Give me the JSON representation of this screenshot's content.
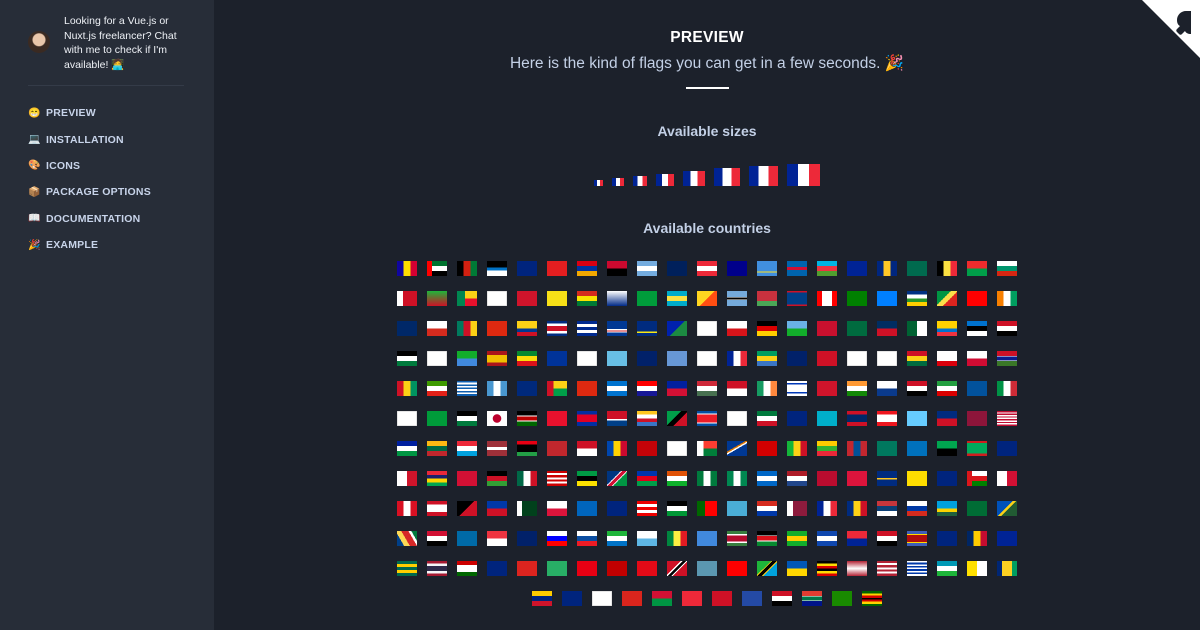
{
  "sidebar": {
    "promo_text": "Looking for a Vue.js or Nuxt.js freelancer? Chat with me to check if I'm available! 🧑‍💻",
    "items": [
      {
        "icon": "😁",
        "label": "PREVIEW",
        "icon_name": "grinning-face-icon"
      },
      {
        "icon": "💻",
        "label": "INSTALLATION",
        "icon_name": "laptop-icon"
      },
      {
        "icon": "🎨",
        "label": "ICONS",
        "icon_name": "palette-icon"
      },
      {
        "icon": "📦",
        "label": "PACKAGE OPTIONS",
        "icon_name": "package-icon"
      },
      {
        "icon": "📖",
        "label": "DOCUMENTATION",
        "icon_name": "book-icon"
      },
      {
        "icon": "🎉",
        "label": "EXAMPLE",
        "icon_name": "party-popper-icon"
      }
    ]
  },
  "main": {
    "title": "PREVIEW",
    "subtitle": "Here is the kind of flags you can get in a few seconds. 🎉",
    "sizes_heading": "Available sizes",
    "countries_heading": "Available countries"
  },
  "size_flag": "fr",
  "size_count": 8,
  "colors": {
    "background": "#1c212b",
    "sidebar": "#272d38",
    "nav_text": "#c8d4ea",
    "heading": "#c3d0e6",
    "corner": "#ffffff"
  },
  "countries": [
    "ad",
    "ae",
    "af",
    "ag",
    "ai",
    "al",
    "am",
    "ao",
    "ar",
    "as",
    "at",
    "au",
    "aw",
    "ax",
    "az",
    "ba",
    "bb",
    "bd",
    "be",
    "bf",
    "bg",
    "bh",
    "bi",
    "bj",
    "bl",
    "bm",
    "bn",
    "bo",
    "bq",
    "br",
    "bs",
    "bt",
    "bw",
    "by",
    "bz",
    "ca",
    "cc",
    "cd",
    "cf",
    "cg",
    "ch",
    "ci",
    "ck",
    "cl",
    "cm",
    "cn",
    "co",
    "cr",
    "cu",
    "cv",
    "cw",
    "cx",
    "cy",
    "cz",
    "de",
    "dj",
    "dk",
    "dm",
    "do",
    "dz",
    "ec",
    "ee",
    "eg",
    "eh",
    "en",
    "er",
    "es",
    "et",
    "eu",
    "fi",
    "fj",
    "fk",
    "fm",
    "fo",
    "fr",
    "ga",
    "gb",
    "gd",
    "ge",
    "gg",
    "gh",
    "gi",
    "gl",
    "gm",
    "gn",
    "gq",
    "gr",
    "gt",
    "gu",
    "gw",
    "hk",
    "hn",
    "hr",
    "ht",
    "hu",
    "id",
    "ie",
    "il",
    "im",
    "in",
    "io",
    "iq",
    "ir",
    "is",
    "it",
    "je",
    "jm",
    "jo",
    "jp",
    "ke",
    "kg",
    "kh",
    "ki",
    "km",
    "kn",
    "kp",
    "kr",
    "kw",
    "ky",
    "kz",
    "la",
    "lb",
    "lc",
    "li",
    "lk",
    "lr",
    "ls",
    "lt",
    "lu",
    "lv",
    "ly",
    "ma",
    "mc",
    "md",
    "me",
    "mf",
    "mg",
    "mh",
    "mk",
    "ml",
    "mm",
    "mn",
    "mo",
    "mp",
    "mq",
    "mr",
    "ms",
    "mt",
    "mu",
    "mv",
    "mw",
    "mx",
    "my",
    "mz",
    "na",
    "nc",
    "ne",
    "nf",
    "ng",
    "ni",
    "nl",
    "no",
    "np",
    "nr",
    "nu",
    "nz",
    "om",
    "pa",
    "pe",
    "pf",
    "pg",
    "ph",
    "pk",
    "pl",
    "pm",
    "pn",
    "pr",
    "ps",
    "pt",
    "pw",
    "py",
    "qa",
    "re",
    "ro",
    "rs",
    "ru",
    "rw",
    "sa",
    "sb",
    "sc",
    "sd",
    "se",
    "sg",
    "sh",
    "si",
    "sk",
    "sl",
    "sm",
    "sn",
    "so",
    "sr",
    "ss",
    "st",
    "sv",
    "sx",
    "sy",
    "sz",
    "tc",
    "td",
    "tf",
    "tg",
    "th",
    "tj",
    "tk",
    "tl",
    "tm",
    "tn",
    "to",
    "tr",
    "tt",
    "tv",
    "tw",
    "tz",
    "ua",
    "ug",
    "um",
    "us",
    "uy",
    "uz",
    "va",
    "vc",
    "ve",
    "vg",
    "vi",
    "vn",
    "vu",
    "wf",
    "ws",
    "xk",
    "ye",
    "za",
    "zm",
    "zw"
  ],
  "flag_styles": {
    "fr": "linear-gradient(90deg,#002395 33.3%,#fff 33.3% 66.6%,#ed2939 66.6%)",
    "ad": "linear-gradient(90deg,#10069f 33%,#fedd00 33% 67%,#d50032 67%)",
    "ae": "linear-gradient(90deg,#ff0000 25%,transparent 25%),linear-gradient(#00732f 33%,#fff 33% 66%,#000 66%)",
    "af": "linear-gradient(90deg,#000 33%,#d32011 33% 67%,#007a36 67%)",
    "ag": "linear-gradient(#000 45%,#0072c6 45% 62%,#fff 62%)",
    "ai": "linear-gradient(#00247d,#00247d)",
    "al": "linear-gradient(#e41e20,#e41e20)",
    "am": "linear-gradient(#d90012 33%,#0033a0 33% 67%,#f2a800 67%)",
    "ao": "linear-gradient(#cc092f 50%,#000 50%)",
    "ar": "linear-gradient(#74acdf 33%,#fff 33% 67%,#74acdf 67%)",
    "as": "linear-gradient(#00205b,#00205b)",
    "at": "linear-gradient(#ed2939 33%,#fff 33% 67%,#ed2939 67%)",
    "au": "linear-gradient(#00008b,#00008b)",
    "aw": "linear-gradient(#418fde 70%,#fbe122 70% 78%,#418fde 78%)",
    "ax": "linear-gradient(#0064ad 40%,#d21034 40% 60%,#0064ad 60%)",
    "az": "linear-gradient(#00b5e2 33%,#ef3340 33% 67%,#509e2f 67%)",
    "ba": "linear-gradient(#002395,#002395)",
    "bb": "linear-gradient(90deg,#00267f 33%,#ffc726 33% 67%,#00267f 67%)",
    "bd": "linear-gradient(#006a4e,#006a4e)",
    "be": "linear-gradient(90deg,#000 33%,#fae042 33% 67%,#ed2939 67%)",
    "bf": "linear-gradient(#ef2b2d 50%,#009e49 50%)",
    "bg": "linear-gradient(#fff 33%,#00966e 33% 67%,#d62612 67%)",
    "bh": "linear-gradient(90deg,#fff 30%,#ce1126 30%)",
    "bi": "linear-gradient(#1eb53a,#ce1126)",
    "bj": "linear-gradient(90deg,#008751 40%,transparent 40%),linear-gradient(#fcd116 50%,#e8112d 50%)",
    "bl": "linear-gradient(#fff,#fff)",
    "bm": "linear-gradient(#cf142b,#cf142b)",
    "bn": "linear-gradient(#f7e017,#f7e017)",
    "bo": "linear-gradient(#d52b1e 33%,#f9e300 33% 67%,#007934 67%)",
    "bq": "linear-gradient(#fff,#012a87)",
    "br": "linear-gradient(#009c3b,#009c3b)",
    "bs": "linear-gradient(#00abc9 33%,#fae042 33% 67%,#00abc9 67%)",
    "bt": "linear-gradient(135deg,#ffd520 50%,#ff4e12 50%)",
    "bw": "linear-gradient(#75aadb 40%,#fff 40% 44%,#000 44% 56%,#fff 56% 60%,#75aadb 60%)",
    "by": "linear-gradient(#c8313e 66%,#4aa657 66%)",
    "bz": "linear-gradient(#ce1126 10%,#003f87 10% 90%,#ce1126 90%)",
    "ca": "linear-gradient(90deg,#ff0000 25%,#fff 25% 75%,#ff0000 75%)",
    "cc": "linear-gradient(#008000,#008000)",
    "cd": "linear-gradient(#007fff,#007fff)",
    "cf": "linear-gradient(#003082 25%,#fff 25% 50%,#289728 50% 75%,#ffce00 75%)",
    "cg": "linear-gradient(135deg,#009543 40%,#fbde4a 40% 60%,#dc241f 60%)",
    "ch": "linear-gradient(#ff0000,#ff0000)",
    "ci": "linear-gradient(90deg,#f77f00 33%,#fff 33% 67%,#009e60 67%)",
    "ck": "linear-gradient(#002868,#002868)",
    "cl": "linear-gradient(#fff 50%,#d52b1e 50%)",
    "cm": "linear-gradient(90deg,#007a5e 33%,#ce1126 33% 67%,#fcd116 67%)",
    "cn": "linear-gradient(#de2910,#de2910)",
    "co": "linear-gradient(#fcd116 50%,#003893 50% 75%,#ce1126 75%)",
    "cr": "linear-gradient(#002b7f 17%,#fff 17% 33%,#ce1126 33% 67%,#fff 67% 83%,#002b7f 83%)",
    "cu": "linear-gradient(#002a8f 20%,#fff 20% 40%,#002a8f 40% 60%,#fff 60% 80%,#002a8f 80%)",
    "cv": "linear-gradient(#003893 55%,#fff 55% 62%,#cf2027 62% 70%,#fff 70% 77%,#003893 77%)",
    "cw": "linear-gradient(#002b7f 70%,#f9e814 70% 80%,#002b7f 80%)",
    "cx": "linear-gradient(135deg,#0021ad 50%,#1c8a42 50%)",
    "cy": "linear-gradient(#fff,#fff)",
    "cz": "linear-gradient(#fff 50%,#d7141a 50%)",
    "de": "linear-gradient(#000 33%,#dd0000 33% 67%,#ffce00 67%)",
    "dj": "linear-gradient(#6ab2e7 50%,#12ad2b 50%)",
    "dk": "linear-gradient(#c8102e,#c8102e)",
    "dm": "linear-gradient(#006b3f,#006b3f)",
    "do": "linear-gradient(#002d62 50%,#ce1126 50%)",
    "dz": "linear-gradient(90deg,#006233 50%,#fff 50%)",
    "ec": "linear-gradient(#ffd100 50%,#0072ce 50% 75%,#ef3340 75%)",
    "ee": "linear-gradient(#0072ce 33%,#000 33% 67%,#fff 67%)",
    "eg": "linear-gradient(#ce1126 33%,#fff 33% 67%,#000 67%)",
    "eh": "linear-gradient(#000 33%,#fff 33% 67%,#007a3d 67%)",
    "en": "linear-gradient(#fff,#fff)",
    "er": "linear-gradient(#12ad2b 50%,#4189dd 50%)",
    "es": "linear-gradient(#aa151b 25%,#f1bf00 25% 75%,#aa151b 75%)",
    "et": "linear-gradient(#078930 33%,#fcdd09 33% 67%,#da121a 67%)",
    "eu": "linear-gradient(#003399,#003399)",
    "fi": "linear-gradient(#fff,#fff)",
    "fj": "linear-gradient(#68bfe5,#68bfe5)",
    "fk": "linear-gradient(#012169,#012169)",
    "fm": "linear-gradient(#6797d6,#6797d6)",
    "fo": "linear-gradient(#fff,#fff)",
    "ga": "linear-gradient(#009e60 33%,#fcd116 33% 67%,#3a75c4 67%)",
    "gb": "linear-gradient(#012169,#012169)",
    "gd": "linear-gradient(#ce1126,#ce1126)",
    "ge": "linear-gradient(#fff,#fff)",
    "gg": "linear-gradient(#fff,#fff)",
    "gh": "linear-gradient(#ce1126 33%,#fcd116 33% 67%,#006b3f 67%)",
    "gi": "linear-gradient(#fff 65%,#da000c 65%)",
    "gl": "linear-gradient(#fff 50%,#d00c33 50%)",
    "gm": "linear-gradient(#ce1126 33%,#fff 33% 38%,#0c1c8c 38% 62%,#fff 62% 67%,#3a7728 67%)",
    "gn": "linear-gradient(90deg,#ce1126 33%,#fcd116 33% 67%,#009460 67%)",
    "gq": "linear-gradient(#3e9a00 33%,#fff 33% 67%,#e32118 67%)",
    "gr": "linear-gradient(#0d5eaf 11%,#fff 11% 22%,#0d5eaf 22% 33%,#fff 33% 44%,#0d5eaf 44% 55%,#fff 55% 66%,#0d5eaf 66% 77%,#fff 77% 88%,#0d5eaf 88%)",
    "gt": "linear-gradient(90deg,#4997d0 33%,#fff 33% 67%,#4997d0 67%)",
    "gu": "linear-gradient(#00297b,#00297b)",
    "gw": "linear-gradient(90deg,#ce1126 33%,transparent 33%),linear-gradient(#fcd116 50%,#009e49 50%)",
    "hk": "linear-gradient(#de2910,#de2910)",
    "hn": "linear-gradient(#0073cf 33%,#fff 33% 67%,#0073cf 67%)",
    "hr": "linear-gradient(#ff0000 33%,#fff 33% 67%,#171796 67%)",
    "ht": "linear-gradient(#00209f 50%,#d21034 50%)",
    "hu": "linear-gradient(#ce2939 33%,#fff 33% 67%,#477050 67%)",
    "id": "linear-gradient(#ce1126 50%,#fff 50%)",
    "ie": "linear-gradient(90deg,#169b62 33%,#fff 33% 67%,#ff883e 67%)",
    "il": "linear-gradient(#fff 15%,#0038b8 15% 25%,#fff 25% 75%,#0038b8 75% 85%,#fff 85%)",
    "im": "linear-gradient(#cf142b,#cf142b)",
    "in": "linear-gradient(#ff9933 33%,#fff 33% 67%,#138808 67%)",
    "io": "linear-gradient(#fff 50%,#0a3a8c 50%)",
    "iq": "linear-gradient(#ce1126 33%,#fff 33% 67%,#000 67%)",
    "ir": "linear-gradient(#239f40 33%,#fff 33% 67%,#da0000 67%)",
    "is": "linear-gradient(#02529c,#02529c)",
    "it": "linear-gradient(90deg,#009246 33%,#fff 33% 67%,#ce2b37 67%)",
    "je": "linear-gradient(#fff,#fff)",
    "jm": "linear-gradient(#009b3a,#009b3a)",
    "jo": "linear-gradient(#000 33%,#fff 33% 67%,#007a3d 67%)",
    "jp": "radial-gradient(circle,#bc002d 0 4px,#fff 4.5px)",
    "ke": "linear-gradient(#000 30%,#fff 30% 36%,#bb0000 36% 64%,#fff 64% 70%,#006600 70%)",
    "kg": "linear-gradient(#e8112d,#e8112d)",
    "kh": "linear-gradient(#032ea1 25%,#e00025 25% 75%,#032ea1 75%)",
    "ki": "linear-gradient(#ce1126 55%,#fff 55% 65%,#003f87 65%)",
    "km": "linear-gradient(#ffc61e 25%,#fff 25% 50%,#ce1126 50% 75%,#3a75c4 75%)",
    "kn": "linear-gradient(135deg,#009e49 40%,#000 40% 60%,#ce1126 60%)",
    "kp": "linear-gradient(#024fa2 18%,#fff 18% 22%,#ed1c27 22% 78%,#fff 78% 82%,#024fa2 82%)",
    "kr": "linear-gradient(#fff,#fff)",
    "kw": "linear-gradient(#007a3d 33%,#fff 33% 67%,#ce1126 67%)",
    "ky": "linear-gradient(#00247d,#00247d)",
    "kz": "linear-gradient(#00afca,#00afca)",
    "la": "linear-gradient(#ce1126 25%,#002868 25% 75%,#ce1126 75%)",
    "lb": "linear-gradient(#ee161f 25%,#fff 25% 75%,#ee161f 75%)",
    "lc": "linear-gradient(#66ccff,#66ccff)",
    "li": "linear-gradient(#002b7f 50%,#ce1126 50%)",
    "lk": "linear-gradient(#8d153a,#8d153a)",
    "lr": "linear-gradient(#bf0a30 9%,#fff 9% 18%,#bf0a30 18% 27%,#fff 27% 36%,#bf0a30 36% 45%,#fff 45% 54%,#bf0a30 54% 63%,#fff 63% 72%,#bf0a30 72% 81%,#fff 81% 90%,#bf0a30 90%)",
    "ls": "linear-gradient(#00209f 33%,#fff 33% 67%,#009543 67%)",
    "lt": "linear-gradient(#fdb913 33%,#006a44 33% 67%,#c1272d 67%)",
    "lu": "linear-gradient(#ed2939 33%,#fff 33% 67%,#00a1de 67%)",
    "lv": "linear-gradient(#9e3039 40%,#fff 40% 60%,#9e3039 60%)",
    "ly": "linear-gradient(#e70013 25%,#000 25% 75%,#239e46 75%)",
    "ma": "linear-gradient(#c1272d,#c1272d)",
    "mc": "linear-gradient(#ce1126 50%,#fff 50%)",
    "md": "linear-gradient(90deg,#0046ae 33%,#ffd200 33% 67%,#cc092f 67%)",
    "me": "linear-gradient(#c40308,#c40308)",
    "mf": "linear-gradient(#fff,#fff)",
    "mg": "linear-gradient(90deg,#fff 33%,transparent 33%),linear-gradient(#fc3d32 50%,#007e3a 50%)",
    "mh": "linear-gradient(150deg,#003893 40%,#dd7500 40% 46%,#fff 46% 52%,#003893 52%)",
    "mk": "linear-gradient(#d20000,#d20000)",
    "ml": "linear-gradient(90deg,#14b53a 33%,#fcd116 33% 67%,#ce1126 67%)",
    "mm": "linear-gradient(#fecb00 33%,#34b233 33% 67%,#ea2839 67%)",
    "mn": "linear-gradient(90deg,#c4272f 33%,#015197 33% 67%,#c4272f 67%)",
    "mo": "linear-gradient(#00785e,#00785e)",
    "mp": "linear-gradient(#0071bc,#0071bc)",
    "mq": "linear-gradient(#00a650 50%,#000 50%)",
    "mr": "linear-gradient(#d01c1f 15%,#00a95c 15% 85%,#d01c1f 85%)",
    "ms": "linear-gradient(#00247d,#00247d)",
    "mt": "linear-gradient(90deg,#fff 50%,#cf142b 50%)",
    "mu": "linear-gradient(#ea2839 25%,#1a206d 25% 50%,#ffd500 50% 75%,#00a551 75%)",
    "mv": "linear-gradient(#d21034,#d21034)",
    "mw": "linear-gradient(#000 33%,#ce1126 33% 67%,#339e35 67%)",
    "mx": "linear-gradient(90deg,#006847 33%,#fff 33% 67%,#ce1126 67%)",
    "my": "linear-gradient(#cc0001 14%,#fff 14% 28%,#cc0001 28% 42%,#fff 42% 56%,#cc0001 56% 70%,#fff 70% 84%,#cc0001 84%)",
    "mz": "linear-gradient(#009a44 33%,#000 33% 67%,#fce100 67%)",
    "na": "linear-gradient(135deg,#003580 40%,#fff 40% 44%,#d21034 44% 56%,#fff 56% 60%,#009543 60%)",
    "nc": "linear-gradient(#0035ad 33%,#e2001a 33% 67%,#009e49 67%)",
    "ne": "linear-gradient(#e05206 33%,#fff 33% 67%,#0db02b 67%)",
    "nf": "linear-gradient(90deg,#007a3d 33%,#fff 33% 67%,#007a3d 67%)",
    "ng": "linear-gradient(90deg,#008751 33%,#fff 33% 67%,#008751 67%)",
    "ni": "linear-gradient(#0067c6 33%,#fff 33% 67%,#0067c6 67%)",
    "nl": "linear-gradient(#ae1c28 33%,#fff 33% 67%,#21468b 67%)",
    "no": "linear-gradient(#ba0c2f,#ba0c2f)",
    "np": "linear-gradient(#dc143c,#dc143c)",
    "nr": "linear-gradient(#002b7f 45%,#ffc61e 45% 55%,#002b7f 55%)",
    "nu": "linear-gradient(#fedd00,#fedd00)",
    "nz": "linear-gradient(#00247d,#00247d)",
    "om": "linear-gradient(90deg,#db161b 25%,transparent 25%),linear-gradient(#fff 33%,#db161b 33% 67%,#008000 67%)",
    "pa": "linear-gradient(90deg,#fff 50%,#d21034 50%)",
    "pe": "linear-gradient(90deg,#d91023 33%,#fff 33% 67%,#d91023 67%)",
    "pf": "linear-gradient(#ce1126 25%,#fff 25% 75%,#ce1126 75%)",
    "pg": "linear-gradient(135deg,#000 50%,#ce1126 50%)",
    "ph": "linear-gradient(#0038a8 50%,#ce1126 50%)",
    "pk": "linear-gradient(90deg,#fff 25%,#01411c 25%)",
    "pl": "linear-gradient(#fff 50%,#dc143c 50%)",
    "pm": "linear-gradient(#0065bd,#0065bd)",
    "pn": "linear-gradient(#00247d,#00247d)",
    "pr": "linear-gradient(#ed0000 20%,#fff 20% 40%,#ed0000 40% 60%,#fff 60% 80%,#ed0000 80%)",
    "ps": "linear-gradient(#000 33%,#fff 33% 67%,#009736 67%)",
    "pt": "linear-gradient(90deg,#006600 40%,#ff0000 40%)",
    "pw": "linear-gradient(#4aadd6,#4aadd6)",
    "py": "linear-gradient(#d52b1e 33%,#fff 33% 67%,#0038a8 67%)",
    "qa": "linear-gradient(90deg,#fff 30%,#8d1b3d 30%)",
    "re": "linear-gradient(90deg,#002395 33%,#fff 33% 67%,#ed2939 67%)",
    "ro": "linear-gradient(90deg,#002b7f 33%,#fcd116 33% 67%,#ce1126 67%)",
    "rs": "linear-gradient(#c6363c 33%,#0c4076 33% 67%,#fff 67%)",
    "ru": "linear-gradient(#fff 33%,#0039a6 33% 67%,#d52b1e 67%)",
    "rw": "linear-gradient(#00a1de 50%,#fad201 50% 75%,#20603d 75%)",
    "sa": "linear-gradient(#006c35,#006c35)",
    "sb": "linear-gradient(135deg,#0051ba 45%,#fcd116 45% 55%,#215b33 55%)",
    "sc": "linear-gradient(60deg,#003f87 25%,#fcd856 25% 45%,#d62828 45% 70%,#fff 70% 80%,#007a3d 80%)",
    "sd": "linear-gradient(#d21034 33%,#fff 33% 67%,#000 67%)",
    "se": "linear-gradient(#006aa7,#006aa7)",
    "sg": "linear-gradient(#ef3340 50%,#fff 50%)",
    "sh": "linear-gradient(#012169,#012169)",
    "si": "linear-gradient(#fff 33%,#0000ff 33% 67%,#ff0000 67%)",
    "sk": "linear-gradient(#fff 33%,#0b4ea2 33% 67%,#ee1c25 67%)",
    "sl": "linear-gradient(#1eb53a 33%,#fff 33% 67%,#0072c6 67%)",
    "sm": "linear-gradient(#fff 50%,#5eb6e4 50%)",
    "sn": "linear-gradient(90deg,#00853f 33%,#fdef42 33% 67%,#e31b23 67%)",
    "so": "linear-gradient(#4189dd,#4189dd)",
    "sr": "linear-gradient(#377e3f 20%,#fff 20% 30%,#b40a2d 30% 70%,#fff 70% 80%,#377e3f 80%)",
    "ss": "linear-gradient(#000 30%,#fff 30% 35%,#da121a 35% 65%,#fff 65% 70%,#078930 70%)",
    "st": "linear-gradient(#12ad2b 33%,#ffce00 33% 67%,#12ad2b 67%)",
    "sv": "linear-gradient(#0f47af 33%,#fff 33% 67%,#0f47af 67%)",
    "sx": "linear-gradient(#ed2939 50%,#002395 50%)",
    "sy": "linear-gradient(#ce1126 33%,#fff 33% 67%,#000 67%)",
    "sz": "linear-gradient(#3e5eb9 20%,#ffd900 20% 26%,#b10c0c 26% 74%,#ffd900 74% 80%,#3e5eb9 80%)",
    "tc": "linear-gradient(#00247d,#00247d)",
    "td": "linear-gradient(90deg,#002664 33%,#fecb00 33% 67%,#c60c30 67%)",
    "tf": "linear-gradient(#002395,#002395)",
    "tg": "linear-gradient(#006a4e 20%,#ffce00 20% 40%,#006a4e 40% 60%,#ffce00 60% 80%,#006a4e 80%)",
    "th": "linear-gradient(#a51931 17%,#f4f5f8 17% 33%,#2d2a4a 33% 67%,#f4f5f8 67% 83%,#a51931 83%)",
    "tj": "linear-gradient(#cc0000 28%,#fff 28% 72%,#006600 72%)",
    "tk": "linear-gradient(#00247d,#00247d)",
    "tl": "linear-gradient(#dc241f,#dc241f)",
    "tm": "linear-gradient(#28ae66,#28ae66)",
    "tn": "linear-gradient(#e70013,#e70013)",
    "to": "linear-gradient(#c10000,#c10000)",
    "tr": "linear-gradient(#e30a17,#e30a17)",
    "tt": "linear-gradient(135deg,#ce1126 40%,#fff 40% 45%,#000 45% 55%,#fff 55% 60%,#ce1126 60%)",
    "tv": "linear-gradient(#5b97b1,#5b97b1)",
    "tw": "linear-gradient(#fe0000,#fe0000)",
    "tz": "linear-gradient(135deg,#1eb53a 40%,#fcd116 40% 44%,#000 44% 56%,#fcd116 56% 60%,#00a3dd 60%)",
    "ua": "linear-gradient(#0057b7 50%,#ffd700 50%)",
    "ug": "linear-gradient(#000 17%,#fcdc04 17% 33%,#d90000 33% 50%,#000 50% 67%,#fcdc04 67% 83%,#d90000 83%)",
    "um": "linear-gradient(#b22234,#fff,#b22234)",
    "us": "linear-gradient(#b22234 14%,#fff 14% 28%,#b22234 28% 42%,#fff 42% 56%,#b22234 56% 70%,#fff 70% 84%,#b22234 84%)",
    "uy": "linear-gradient(#fff 11%,#0038a8 11% 22%,#fff 22% 33%,#0038a8 33% 44%,#fff 44% 55%,#0038a8 55% 66%,#fff 66% 77%,#0038a8 77% 88%,#fff 88%)",
    "uz": "linear-gradient(#0099b5 33%,#fff 33% 67%,#1eb53a 67%)",
    "va": "linear-gradient(90deg,#ffe000 50%,#fff 50%)",
    "vc": "linear-gradient(90deg,#002674 25%,#fcd022 25% 75%,#009e60 75%)",
    "ve": "linear-gradient(#ffcc00 33%,#00247d 33% 67%,#cf142b 67%)",
    "vg": "linear-gradient(#00247d,#00247d)",
    "vi": "linear-gradient(#fff,#fff)",
    "vn": "linear-gradient(#da251d,#da251d)",
    "vu": "linear-gradient(#d21034 50%,#009543 50%)",
    "wf": "linear-gradient(#ed2939,#ed2939)",
    "ws": "linear-gradient(#ce1126,#ce1126)",
    "xk": "linear-gradient(#244aa5,#244aa5)",
    "ye": "linear-gradient(#ce1126 33%,#fff 33% 67%,#000 67%)",
    "za": "linear-gradient(#e03c31 33%,#fff 33% 38%,#007749 38% 62%,#fff 62% 67%,#001489 67%)",
    "zm": "linear-gradient(#198a00,#198a00)",
    "zw": "linear-gradient(#006400 15%,#ffd200 15% 30%,#d40000 30% 45%,#000 45% 55%,#d40000 55% 70%,#ffd200 70% 85%,#006400 85%)"
  }
}
